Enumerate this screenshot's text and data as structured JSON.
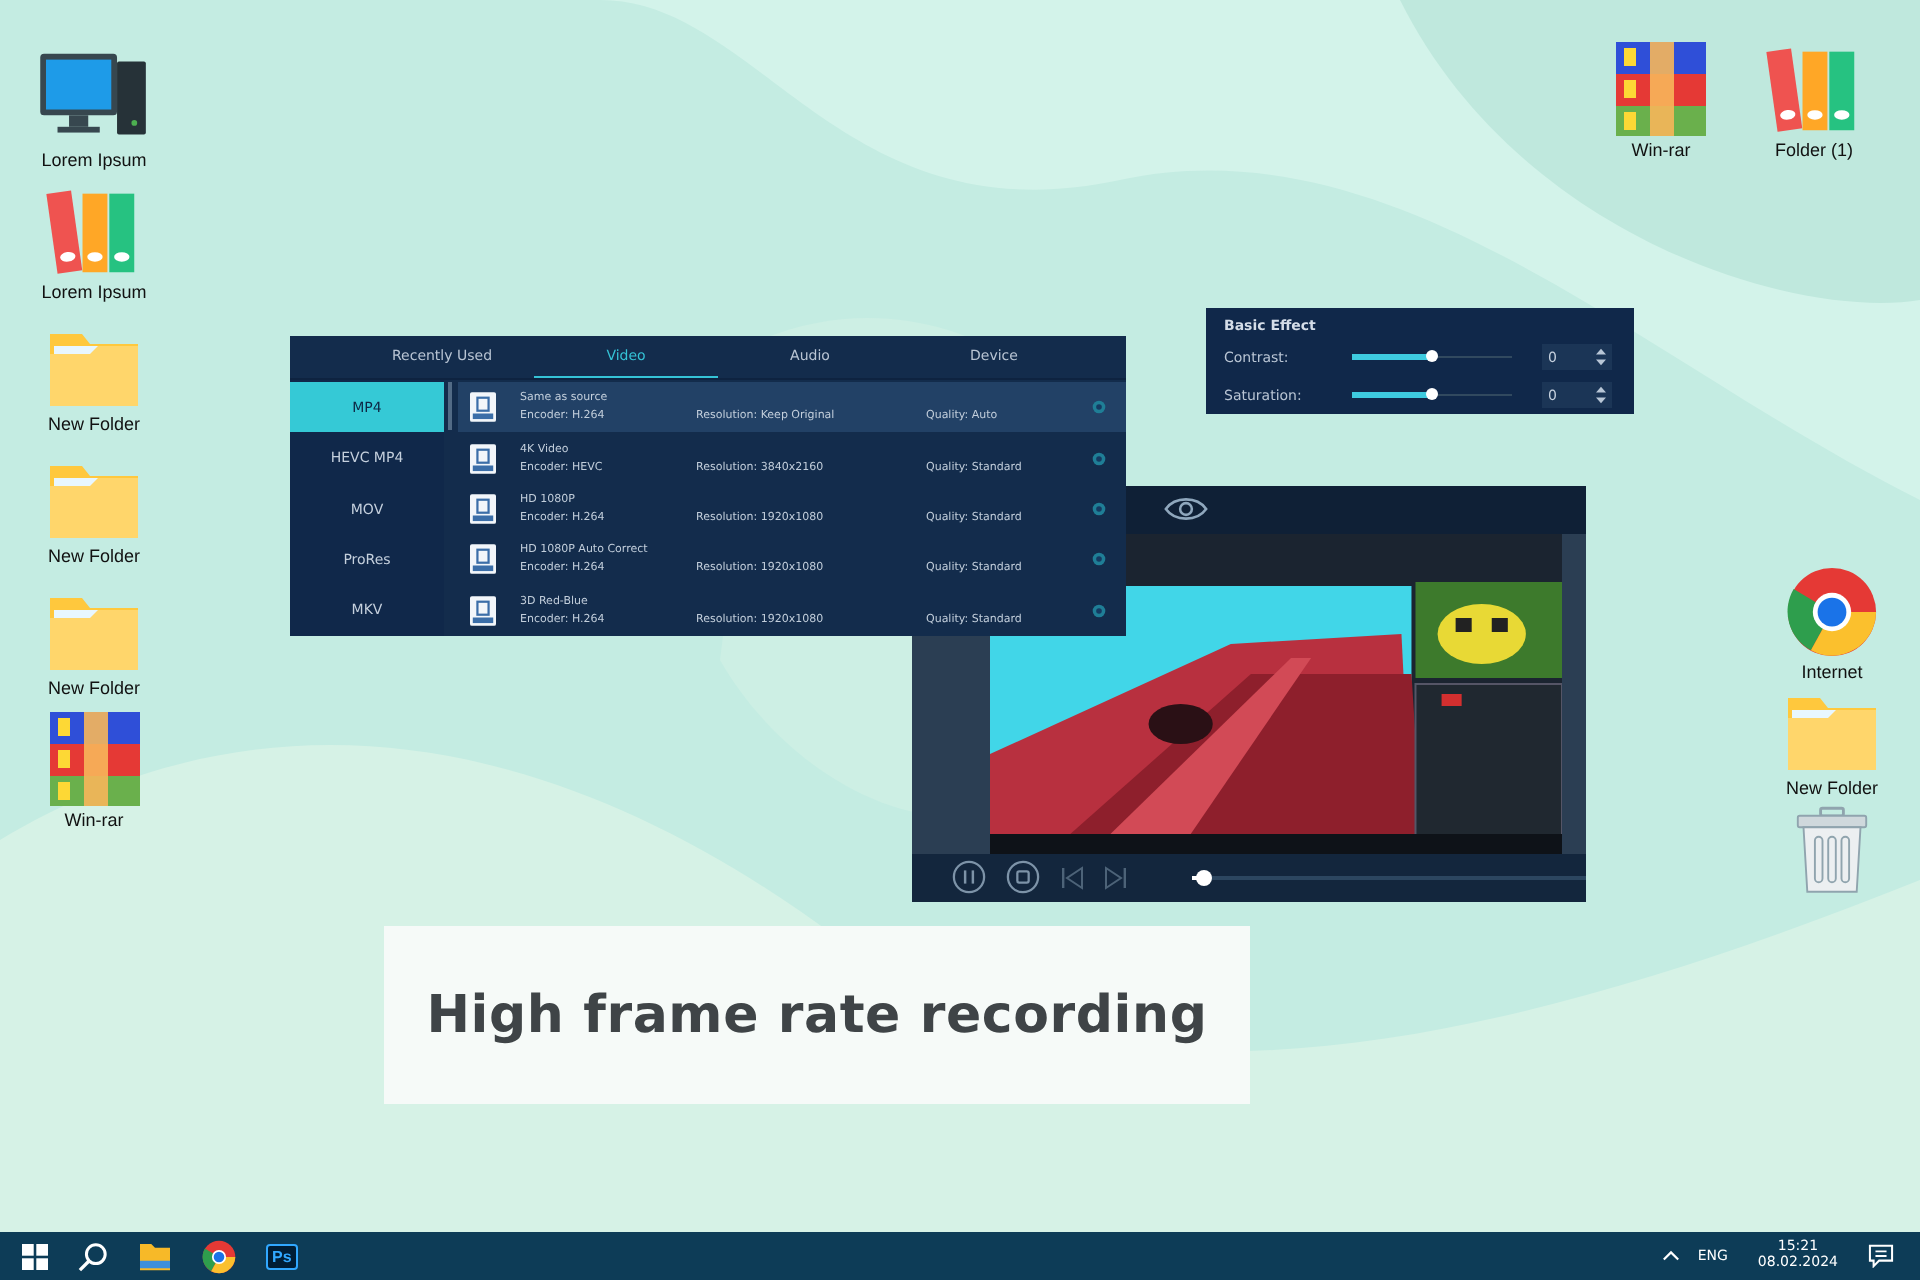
{
  "desktop_icons_left": [
    {
      "kind": "computer",
      "label": "Lorem Ipsum"
    },
    {
      "kind": "binders",
      "label": "Lorem Ipsum"
    },
    {
      "kind": "folder",
      "label": "New Folder"
    },
    {
      "kind": "folder",
      "label": "New Folder"
    },
    {
      "kind": "folder",
      "label": "New Folder"
    },
    {
      "kind": "archive",
      "label": "Win-rar"
    }
  ],
  "desktop_icons_top_right": [
    {
      "kind": "archive",
      "label": "Win-rar"
    },
    {
      "kind": "binders",
      "label": "Folder (1)"
    }
  ],
  "desktop_icons_right": [
    {
      "kind": "browser",
      "label": "Internet"
    },
    {
      "kind": "folder",
      "label": "New Folder"
    },
    {
      "kind": "trash"
    }
  ],
  "format_panel": {
    "tabs": [
      {
        "label": "Recently Used",
        "selected": false
      },
      {
        "label": "Video",
        "selected": true
      },
      {
        "label": "Audio",
        "selected": false
      },
      {
        "label": "Device",
        "selected": false
      }
    ],
    "formats": [
      {
        "label": "MP4",
        "selected": true
      },
      {
        "label": "HEVC MP4",
        "selected": false
      },
      {
        "label": "MOV",
        "selected": false
      },
      {
        "label": "ProRes",
        "selected": false
      },
      {
        "label": "MKV",
        "selected": false
      }
    ],
    "presets": [
      {
        "name": "Same as source",
        "encoder": "Encoder: H.264",
        "resolution": "Resolution: Keep Original",
        "quality": "Quality: Auto",
        "selected": true
      },
      {
        "name": "4K Video",
        "encoder": "Encoder: HEVC",
        "resolution": "Resolution: 3840x2160",
        "quality": "Quality: Standard",
        "selected": false
      },
      {
        "name": "HD 1080P",
        "encoder": "Encoder: H.264",
        "resolution": "Resolution: 1920x1080",
        "quality": "Quality: Standard",
        "selected": false
      },
      {
        "name": "HD 1080P Auto Correct",
        "encoder": "Encoder: H.264",
        "resolution": "Resolution: 1920x1080",
        "quality": "Quality: Standard",
        "selected": false
      },
      {
        "name": "3D Red-Blue",
        "encoder": "Encoder: H.264",
        "resolution": "Resolution: 1920x1080",
        "quality": "Quality: Standard",
        "selected": false
      }
    ]
  },
  "basic_effect": {
    "title": "Basic Effect",
    "sliders": [
      {
        "label": "Contrast:",
        "level": 0.5,
        "value": "0"
      },
      {
        "label": "Saturation:",
        "level": 0.5,
        "value": "0"
      }
    ]
  },
  "player": {
    "progress": {
      "level": 0.03
    }
  },
  "caption": "High frame rate recording",
  "taskbar": {
    "apps": [
      {
        "kind": "search"
      },
      {
        "kind": "explorer"
      },
      {
        "kind": "browser"
      },
      {
        "kind": "photoshop",
        "label": "Ps"
      }
    ],
    "language": "ENG",
    "time": "15:21",
    "date": "08.02.2024"
  }
}
